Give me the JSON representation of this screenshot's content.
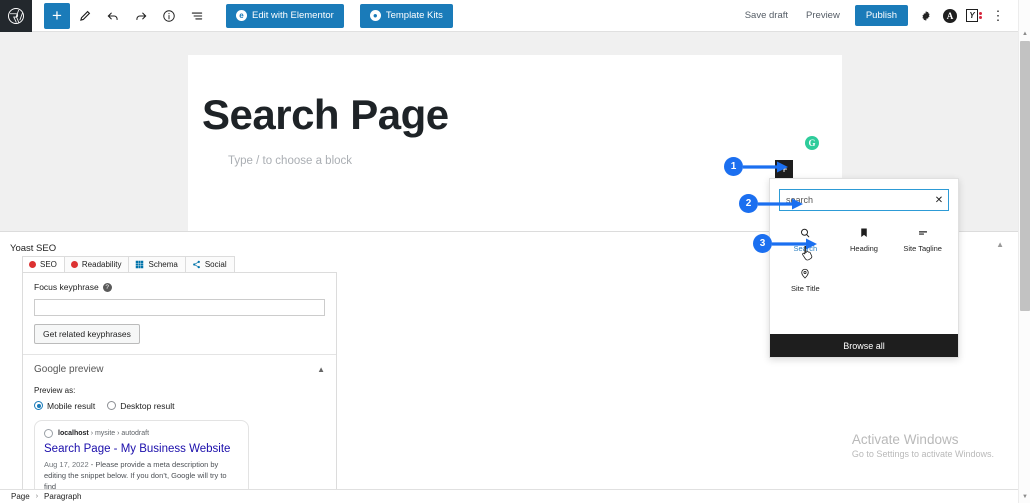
{
  "toolbar": {
    "logo_icon": "wordpress-logo",
    "add_block_label": "+",
    "tools": [
      {
        "name": "edit-tool-icon",
        "glyph": "pencil"
      },
      {
        "name": "undo-icon",
        "glyph": "undo"
      },
      {
        "name": "redo-icon",
        "glyph": "redo"
      },
      {
        "name": "details-info-icon",
        "glyph": "info"
      },
      {
        "name": "list-view-icon",
        "glyph": "list"
      }
    ],
    "elementor_button": "Edit with Elementor",
    "template_kits_button": "Template Kits",
    "save_draft": "Save draft",
    "preview": "Preview",
    "publish": "Publish",
    "settings_icon": "gear-icon",
    "avatar_letter": "A",
    "yoast_letter": "Y",
    "kebab": "⋮"
  },
  "editor": {
    "page_title": "Search Page",
    "block_placeholder": "Type / to choose a block",
    "green_badge_letter": "G",
    "inserter_plus": "+"
  },
  "inserter": {
    "search_value": "search",
    "search_placeholder": "Search",
    "clear_icon": "close-icon",
    "blocks": [
      {
        "label": "Search",
        "icon": "search-icon",
        "active": true
      },
      {
        "label": "Heading",
        "icon": "heading-bookmark-icon",
        "active": false
      },
      {
        "label": "Site Tagline",
        "icon": "site-tagline-lines-icon",
        "active": false
      },
      {
        "label": "Site Title",
        "icon": "site-title-pin-icon",
        "active": false
      }
    ],
    "browse_all": "Browse all"
  },
  "annotations": [
    {
      "number": "1"
    },
    {
      "number": "2"
    },
    {
      "number": "3"
    }
  ],
  "yoast": {
    "panel_title": "Yoast SEO",
    "collapse_icon": "chevron-up-icon",
    "tabs": [
      {
        "label": "SEO",
        "icon": "status-dot",
        "selected": true
      },
      {
        "label": "Readability",
        "icon": "status-dot",
        "selected": false
      },
      {
        "label": "Schema",
        "icon": "grid-icon",
        "selected": false
      },
      {
        "label": "Social",
        "icon": "share-icon",
        "selected": false
      }
    ],
    "focus_keyphrase_label": "Focus keyphrase",
    "focus_keyphrase_value": "",
    "help_icon": "help-icon",
    "related_keyphrases_button": "Get related keyphrases",
    "google_preview_title": "Google preview",
    "preview_as_label": "Preview as:",
    "preview_options": [
      {
        "label": "Mobile result",
        "selected": true
      },
      {
        "label": "Desktop result",
        "selected": false
      }
    ],
    "snippet": {
      "domain": "localhost",
      "path": "› mysite › autodraft",
      "title": "Search Page - My Business Website",
      "date": "Aug 17, 2022",
      "description": "Please provide a meta description by editing the snippet below. If you don’t, Google will try to find"
    }
  },
  "breadcrumb": {
    "items": [
      "Page",
      "Paragraph"
    ],
    "separator": "›"
  },
  "watermark": {
    "line1": "Activate Windows",
    "line2": "Go to Settings to activate Windows."
  },
  "scrollbar": {
    "up_arrow": "▲",
    "down_arrow": "▼"
  },
  "colors": {
    "accent_blue": "#1a7bb9",
    "annotation_blue": "#1b6ff0",
    "yoast_red": "#dc3232",
    "green_badge": "#2ecc9b",
    "link_blue": "#1a0dab"
  }
}
